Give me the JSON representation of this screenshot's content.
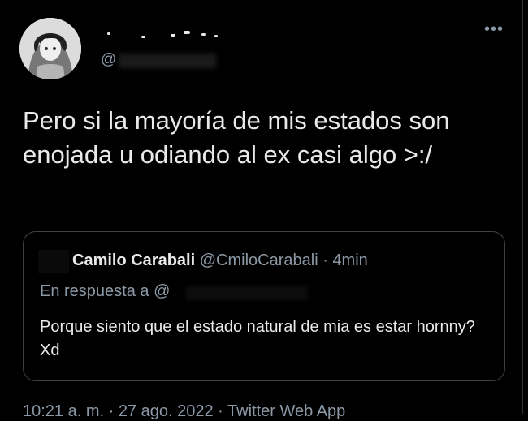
{
  "tweet": {
    "handle_prefix": "@",
    "text": "Pero si la mayoría de mis estados son enojada u odiando al ex casi algo >:/"
  },
  "quoted": {
    "name": "Camilo Carabali",
    "handle": "@CmiloCarabali",
    "separator": "·",
    "time": "4min",
    "reply_label": "En respuesta a",
    "reply_handle_prefix": "@",
    "text": "Porque siento que el estado natural de mia es estar hornny?  Xd"
  },
  "footer": {
    "meta": "10:21 a. m. · 27 ago. 2022 · Twitter Web App"
  },
  "icons": {
    "more": "more-icon"
  },
  "colors": {
    "background": "#000000",
    "text_primary": "#e7e9ea",
    "text_secondary": "#8b98a5",
    "border": "#3e4144"
  }
}
